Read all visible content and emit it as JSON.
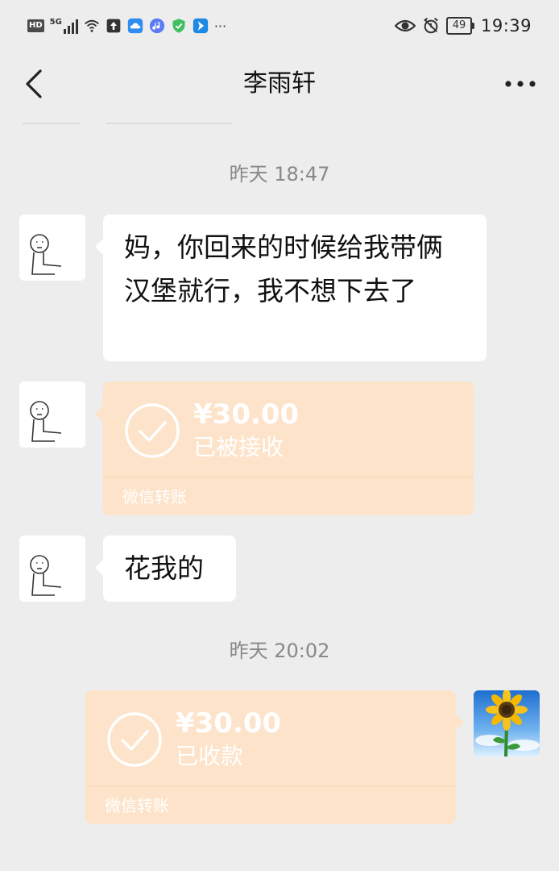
{
  "status_bar": {
    "hd_label": "HD",
    "network": "5G",
    "more": "···",
    "battery": "49",
    "time": "19:39"
  },
  "header": {
    "title": "李雨轩"
  },
  "messages": [
    {
      "type": "timestamp",
      "text": "昨天 18:47"
    },
    {
      "type": "text",
      "side": "left",
      "text": "妈，你回来的时候给我带俩汉堡就行，我不想下去了"
    },
    {
      "type": "transfer",
      "side": "left",
      "amount": "¥30.00",
      "status": "已被接收",
      "footer": "微信转账"
    },
    {
      "type": "text",
      "side": "left",
      "text": "花我的"
    },
    {
      "type": "timestamp",
      "text": "昨天 20:02"
    },
    {
      "type": "transfer",
      "side": "right",
      "amount": "¥30.00",
      "status": "已收款",
      "footer": "微信转账"
    }
  ],
  "colors": {
    "background": "#ededed",
    "bubble": "#ffffff",
    "transfer": "#fde3c9"
  }
}
